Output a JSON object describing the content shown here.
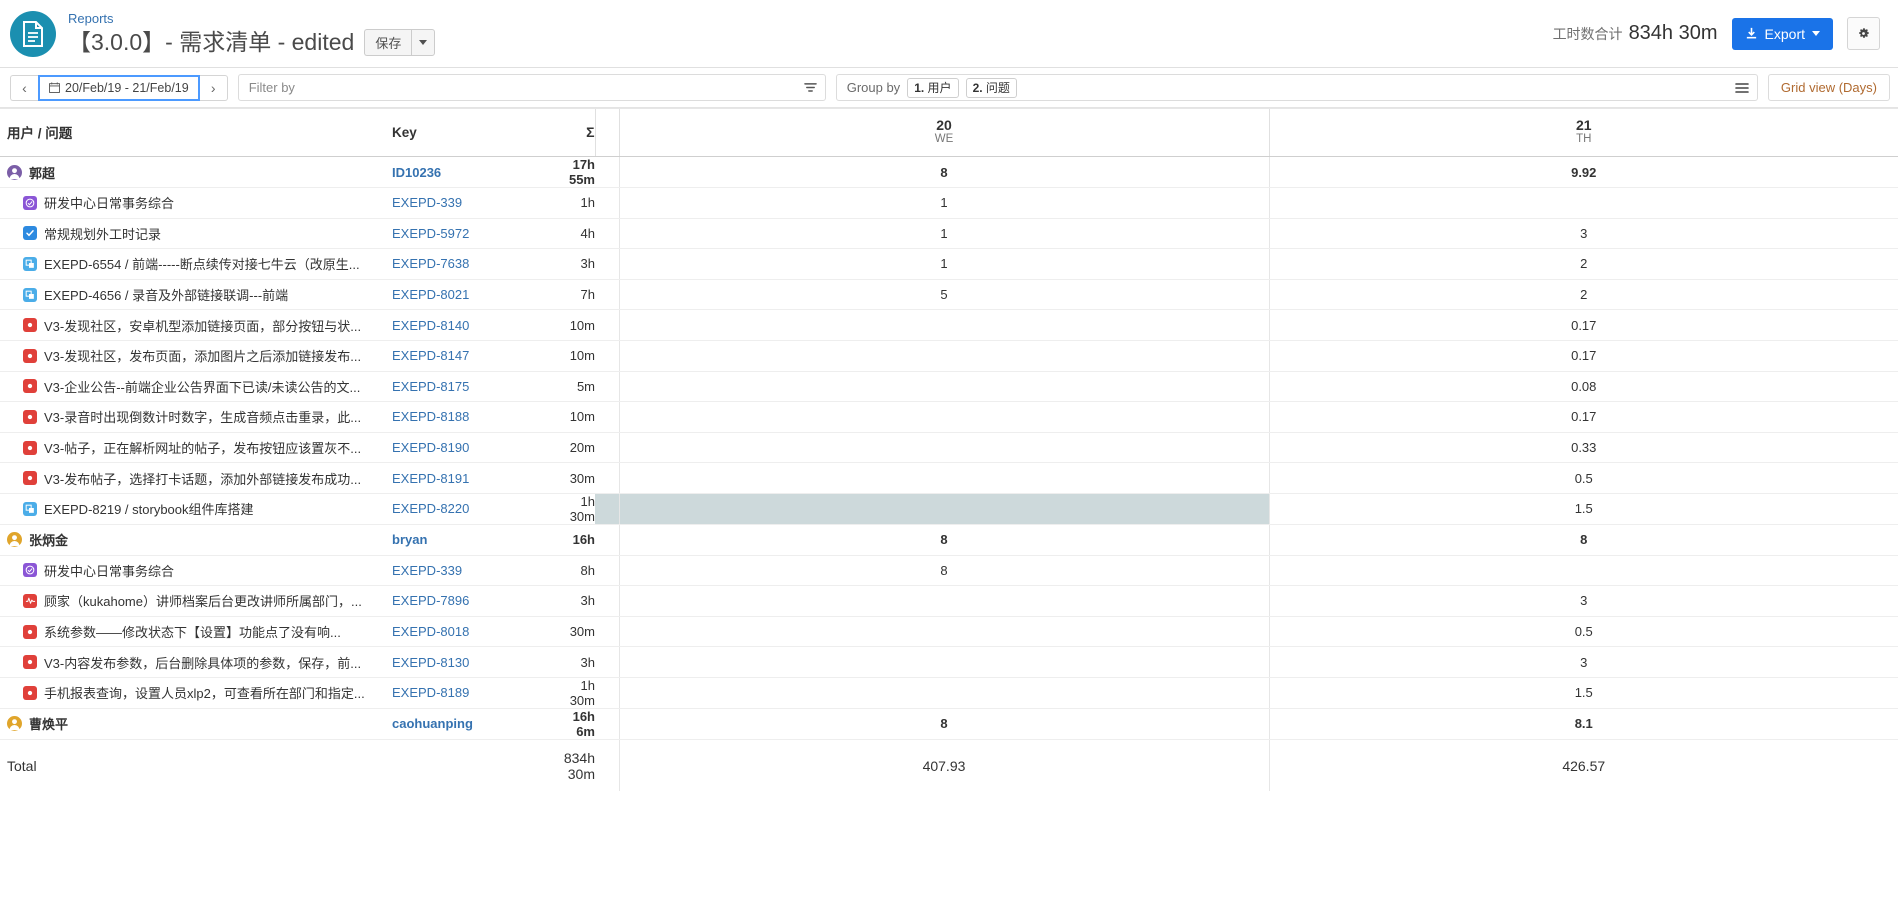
{
  "header": {
    "breadcrumb": "Reports",
    "title": "【3.0.0】- 需求清单 - edited",
    "save_label": "保存",
    "total_label": "工时数合计",
    "total_value": "834h 30m",
    "export_label": "Export",
    "doc_icon": "document-icon",
    "gear_icon": "gear-icon",
    "caret_icon": "chevron-down-icon",
    "accent_blue": "#1a73e8",
    "avatar_teal": "#1b8fb0"
  },
  "toolbar": {
    "prev_label": "‹",
    "next_label": "›",
    "date_range": "20/Feb/19 - 21/Feb/19",
    "calendar_icon": "calendar-icon",
    "filter_placeholder": "Filter by",
    "funnel_icon": "funnel-icon",
    "groupby_label": "Group by",
    "groupby_chips": [
      {
        "num": "1.",
        "label": "用户"
      },
      {
        "num": "2.",
        "label": "问题"
      }
    ],
    "hamburger_icon": "hamburger-icon",
    "gridview_label": "Grid view (Days)",
    "gridview_color": "#b06a30"
  },
  "table": {
    "headers": {
      "name": "用户 / 问题",
      "key": "Key",
      "sum": "Σ",
      "days": [
        {
          "num": "20",
          "dow": "WE"
        },
        {
          "num": "21",
          "dow": "TH"
        }
      ]
    },
    "rows": [
      {
        "type": "group",
        "icon": "avatar-purple-icon",
        "label": "郭超",
        "key": "ID10236",
        "sum": "17h 55m",
        "d1": "8",
        "d2": "9.92"
      },
      {
        "type": "issue",
        "icon": "epic-icon",
        "label": "研发中心日常事务综合",
        "key": "EXEPD-339",
        "sum": "1h",
        "d1": "1",
        "d2": ""
      },
      {
        "type": "issue",
        "icon": "task-icon",
        "label": "常规规划外工时记录",
        "key": "EXEPD-5972",
        "sum": "4h",
        "d1": "1",
        "d2": "3"
      },
      {
        "type": "issue",
        "icon": "subtask-icon",
        "label": "EXEPD-6554 / 前端-----断点续传对接七牛云（改原生...",
        "key": "EXEPD-7638",
        "sum": "3h",
        "d1": "1",
        "d2": "2"
      },
      {
        "type": "issue",
        "icon": "subtask-icon",
        "label": "EXEPD-4656 / 录音及外部链接联调---前端",
        "key": "EXEPD-8021",
        "sum": "7h",
        "d1": "5",
        "d2": "2"
      },
      {
        "type": "issue",
        "icon": "bug-icon",
        "label": "V3-发现社区，安卓机型添加链接页面，部分按钮与状...",
        "key": "EXEPD-8140",
        "sum": "10m",
        "d1": "",
        "d2": "0.17"
      },
      {
        "type": "issue",
        "icon": "bug-icon",
        "label": "V3-发现社区，发布页面，添加图片之后添加链接发布...",
        "key": "EXEPD-8147",
        "sum": "10m",
        "d1": "",
        "d2": "0.17"
      },
      {
        "type": "issue",
        "icon": "bug-icon",
        "label": "V3-企业公告--前端企业公告界面下已读/未读公告的文...",
        "key": "EXEPD-8175",
        "sum": "5m",
        "d1": "",
        "d2": "0.08"
      },
      {
        "type": "issue",
        "icon": "bug-icon",
        "label": "V3-录音时出现倒数计时数字，生成音频点击重录，此...",
        "key": "EXEPD-8188",
        "sum": "10m",
        "d1": "",
        "d2": "0.17"
      },
      {
        "type": "issue",
        "icon": "bug-icon",
        "label": "V3-帖子，正在解析网址的帖子，发布按钮应该置灰不...",
        "key": "EXEPD-8190",
        "sum": "20m",
        "d1": "",
        "d2": "0.33"
      },
      {
        "type": "issue",
        "icon": "bug-icon",
        "label": "V3-发布帖子，选择打卡话题，添加外部链接发布成功...",
        "key": "EXEPD-8191",
        "sum": "30m",
        "d1": "",
        "d2": "0.5"
      },
      {
        "type": "issue",
        "icon": "subtask-icon",
        "label": "EXEPD-8219 / storybook组件库搭建",
        "key": "EXEPD-8220",
        "sum": "1h 30m",
        "d1": "",
        "d2": "1.5",
        "highlight_d1": true
      },
      {
        "type": "group",
        "icon": "avatar-orange-icon",
        "label": "张炳金",
        "key": "bryan",
        "sum": "16h",
        "d1": "8",
        "d2": "8"
      },
      {
        "type": "issue",
        "icon": "epic-icon",
        "label": "研发中心日常事务综合",
        "key": "EXEPD-339",
        "sum": "8h",
        "d1": "8",
        "d2": ""
      },
      {
        "type": "issue",
        "icon": "incident-icon",
        "label": "顾家（kukahome）讲师档案后台更改讲师所属部门，...",
        "key": "EXEPD-7896",
        "sum": "3h",
        "d1": "",
        "d2": "3"
      },
      {
        "type": "issue",
        "icon": "bug-icon",
        "label": "系统参数——修改状态下【设置】功能点了没有响...",
        "key": "EXEPD-8018",
        "sum": "30m",
        "d1": "",
        "d2": "0.5"
      },
      {
        "type": "issue",
        "icon": "bug-icon",
        "label": "V3-内容发布参数，后台删除具体项的参数，保存，前...",
        "key": "EXEPD-8130",
        "sum": "3h",
        "d1": "",
        "d2": "3"
      },
      {
        "type": "issue",
        "icon": "bug-icon",
        "label": "手机报表查询，设置人员xlp2，可查看所在部门和指定...",
        "key": "EXEPD-8189",
        "sum": "1h 30m",
        "d1": "",
        "d2": "1.5"
      },
      {
        "type": "group",
        "icon": "avatar-orange-icon",
        "label": "曹焕平",
        "key": "caohuanping",
        "sum": "16h 6m",
        "d1": "8",
        "d2": "8.1"
      }
    ],
    "footer": {
      "label": "Total",
      "sum": "834h 30m",
      "d1": "407.93",
      "d2": "426.57"
    }
  }
}
